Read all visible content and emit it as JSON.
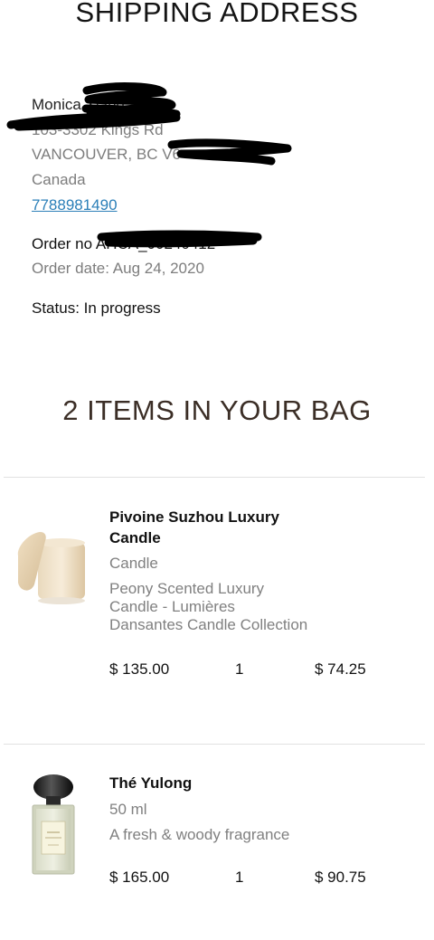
{
  "header": {
    "title": "SHIPPING ADDRESS"
  },
  "address": {
    "name": "Monica Xiang",
    "street": "103-3302 Kings Rd",
    "city_line": "VANCOUVER,  BC  V6",
    "country": "Canada",
    "phone": "7788981490"
  },
  "order": {
    "number_line": "Order no AHCA_00240412",
    "date_line": "Order date: Aug 24, 2020",
    "status_line": "Status: In progress"
  },
  "bag": {
    "title": "2 ITEMS IN YOUR BAG",
    "items": [
      {
        "name_line1": "Pivoine Suzhou Luxury",
        "name_line2": "Candle",
        "category": "Candle",
        "desc_line1": "Peony Scented Luxury",
        "desc_line2": "Candle - Lumières",
        "desc_line3": "Dansantes Candle Collection",
        "price": "$ 135.00",
        "quantity": "1",
        "total": "$ 74.25",
        "image_icon": "candle-image"
      },
      {
        "name_line1": "Thé Yulong",
        "size": "50 ml",
        "description": "A fresh & woody fragrance",
        "price": "$ 165.00",
        "quantity": "1",
        "total": "$ 90.75",
        "image_icon": "perfume-bottle-image"
      }
    ]
  },
  "colors": {
    "link": "#2b7fb8",
    "muted_text": "#808080",
    "bag_title": "#3b2e26",
    "divider": "#e2e2e2"
  }
}
